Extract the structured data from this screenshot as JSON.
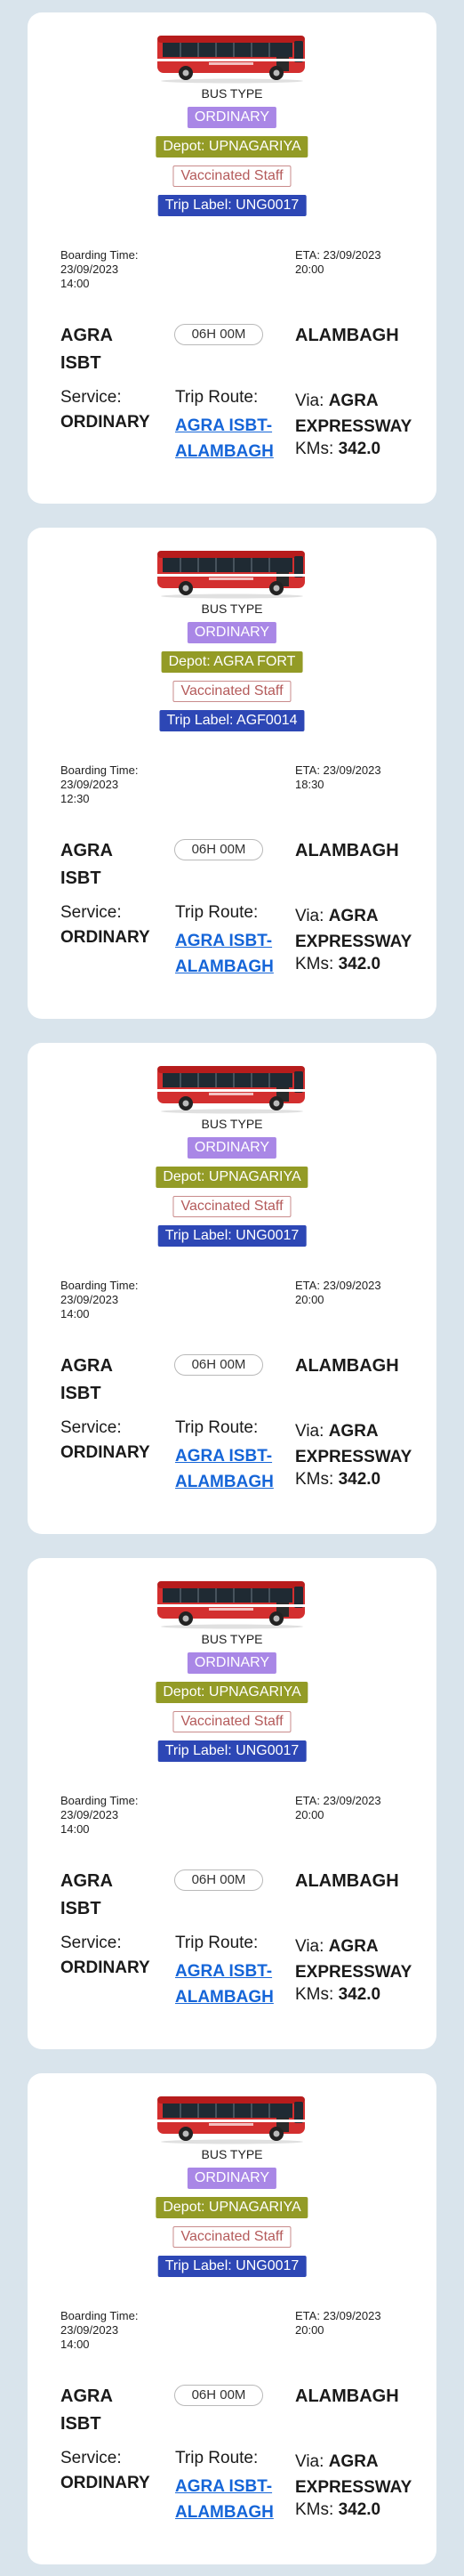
{
  "colors": {
    "background": "#d9e4ec",
    "card": "#ffffff",
    "service_tag": "#a987e6",
    "depot_tag": "#939b26",
    "vaccinated_text": "#b45a5a",
    "trip_tag": "#2d47b5",
    "route_link": "#1565d8",
    "bus_red": "#d32f2f"
  },
  "icons": {
    "bus": "bus-icon"
  },
  "labels": {
    "bus_type": "BUS TYPE",
    "service": "Service:",
    "trip_route": "Trip Route:",
    "via": "Via:",
    "kms": "KMs:"
  },
  "buses": [
    {
      "service_type": "ORDINARY",
      "depot": "Depot: UPNAGARIYA",
      "vaccinated": "Vaccinated Staff",
      "trip_label": "Trip Label: UNG0017",
      "boarding_label": "Boarding Time:",
      "boarding_time": "23/09/2023 14:00",
      "eta": "ETA: 23/09/2023 20:00",
      "from": "AGRA ISBT",
      "duration": "06H 00M",
      "to": "ALAMBAGH",
      "service": "ORDINARY",
      "route": "AGRA ISBT-ALAMBAGH",
      "via": "AGRA EXPRESSWAY",
      "kms": "342.0"
    },
    {
      "service_type": "ORDINARY",
      "depot": "Depot: AGRA FORT",
      "vaccinated": "Vaccinated Staff",
      "trip_label": "Trip Label: AGF0014",
      "boarding_label": "Boarding Time:",
      "boarding_time": "23/09/2023 12:30",
      "eta": "ETA: 23/09/2023 18:30",
      "from": "AGRA ISBT",
      "duration": "06H 00M",
      "to": "ALAMBAGH",
      "service": "ORDINARY",
      "route": "AGRA ISBT-ALAMBAGH",
      "via": "AGRA EXPRESSWAY",
      "kms": "342.0"
    },
    {
      "service_type": "ORDINARY",
      "depot": "Depot: UPNAGARIYA",
      "vaccinated": "Vaccinated Staff",
      "trip_label": "Trip Label: UNG0017",
      "boarding_label": "Boarding Time:",
      "boarding_time": "23/09/2023 14:00",
      "eta": "ETA: 23/09/2023 20:00",
      "from": "AGRA ISBT",
      "duration": "06H 00M",
      "to": "ALAMBAGH",
      "service": "ORDINARY",
      "route": "AGRA ISBT-ALAMBAGH",
      "via": "AGRA EXPRESSWAY",
      "kms": "342.0"
    },
    {
      "service_type": "ORDINARY",
      "depot": "Depot: UPNAGARIYA",
      "vaccinated": "Vaccinated Staff",
      "trip_label": "Trip Label: UNG0017",
      "boarding_label": "Boarding Time:",
      "boarding_time": "23/09/2023 14:00",
      "eta": "ETA: 23/09/2023 20:00",
      "from": "AGRA ISBT",
      "duration": "06H 00M",
      "to": "ALAMBAGH",
      "service": "ORDINARY",
      "route": "AGRA ISBT-ALAMBAGH",
      "via": "AGRA EXPRESSWAY",
      "kms": "342.0"
    },
    {
      "service_type": "ORDINARY",
      "depot": "Depot: UPNAGARIYA",
      "vaccinated": "Vaccinated Staff",
      "trip_label": "Trip Label: UNG0017",
      "boarding_label": "Boarding Time:",
      "boarding_time": "23/09/2023 14:00",
      "eta": "ETA: 23/09/2023 20:00",
      "from": "AGRA ISBT",
      "duration": "06H 00M",
      "to": "ALAMBAGH",
      "service": "ORDINARY",
      "route": "AGRA ISBT-ALAMBAGH",
      "via": "AGRA EXPRESSWAY",
      "kms": "342.0"
    }
  ]
}
